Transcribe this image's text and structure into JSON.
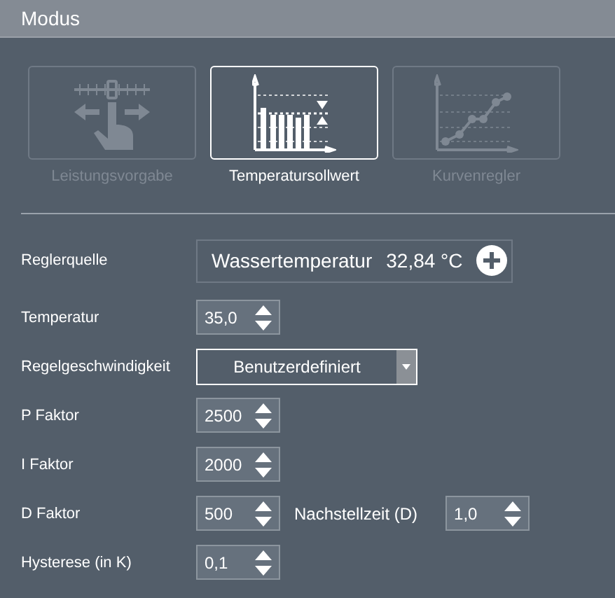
{
  "header": {
    "title": "Modus"
  },
  "modes": [
    {
      "label": "Leistungsvorgabe",
      "kind": "slider",
      "selected": false
    },
    {
      "label": "Temperatursollwert",
      "kind": "bars",
      "selected": true
    },
    {
      "label": "Kurvenregler",
      "kind": "curve",
      "selected": false
    }
  ],
  "rows": [
    {
      "kind": "source",
      "label": "Reglerquelle",
      "source": "Wassertemperatur",
      "reading": "32,84 °C"
    },
    {
      "kind": "spinner",
      "label": "Temperatur",
      "value": "35,0"
    },
    {
      "kind": "dropdown",
      "label": "Regelgeschwindigkeit",
      "value": "Benutzerdefiniert"
    },
    {
      "kind": "spinner",
      "label": "P Faktor",
      "value": "2500"
    },
    {
      "kind": "spinner",
      "label": "I Faktor",
      "value": "2000"
    },
    {
      "kind": "spinner",
      "label": "D Faktor",
      "value": "500",
      "extra_label": "Nachstellzeit (D)",
      "extra_value": "1,0"
    },
    {
      "kind": "spinner",
      "label": "Hysterese (in K)",
      "value": "0,1"
    }
  ]
}
